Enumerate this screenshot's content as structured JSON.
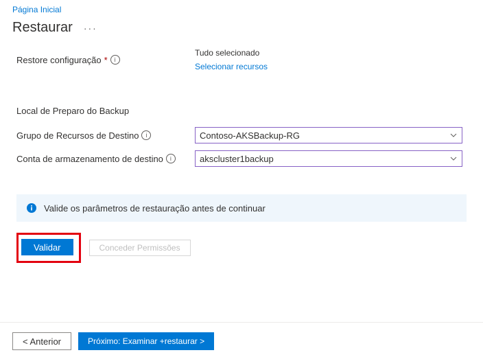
{
  "breadcrumb": {
    "home": "Página Inicial"
  },
  "page": {
    "title": "Restaurar",
    "more": "···"
  },
  "restoreConfig": {
    "label": "Restore configuração",
    "status": "Tudo selecionado",
    "selectLink": "Selecionar recursos"
  },
  "staging": {
    "heading": "Local de Preparo do Backup",
    "rgLabel": "Grupo de Recursos de Destino",
    "rgValue": "Contoso-AKSBackup-RG",
    "storageLabel": "Conta de armazenamento de destino",
    "storageValue": "akscluster1backup"
  },
  "infoBar": {
    "message": "Valide os parâmetros de restauração antes de continuar"
  },
  "buttons": {
    "validate": "Validar",
    "grant": "Conceder Permissões",
    "prev": "<  Anterior",
    "next": "Próximo: Examinar +restaurar >"
  }
}
